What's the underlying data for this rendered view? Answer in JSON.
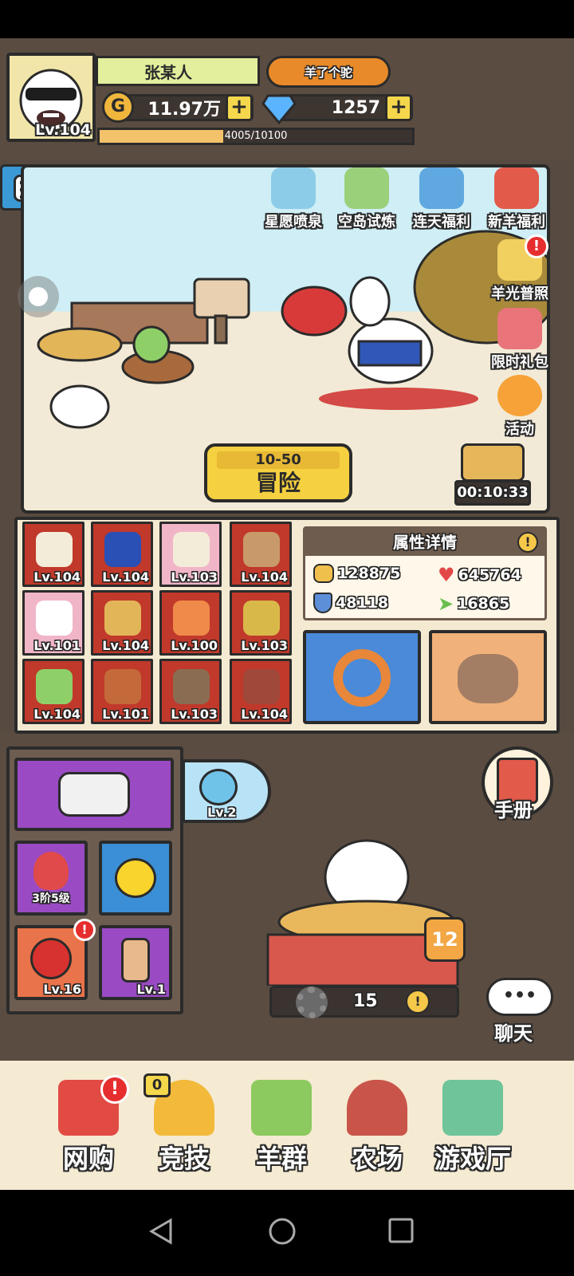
{
  "player": {
    "name": "张某人",
    "level": "Lv.104",
    "title": "羊了个驼"
  },
  "currency": {
    "gold": "11.97万",
    "diamond": "1257"
  },
  "exp": {
    "text": "4005/10100",
    "progress": 0.3965
  },
  "events": {
    "fountain": "星愿喷泉",
    "island": "空岛试炼",
    "daily": "连天福利",
    "newbie": "新羊福利",
    "photo": "羊光普照",
    "gift": "限时礼包",
    "activity": "活动"
  },
  "adventure": {
    "stage": "10-50",
    "label": "冒险"
  },
  "timer": "00:10:33",
  "equipment": [
    "Lv.104",
    "Lv.104",
    "Lv.103",
    "Lv.104",
    "Lv.101",
    "Lv.104",
    "Lv.100",
    "Lv.103",
    "Lv.104",
    "Lv.101",
    "Lv.103",
    "Lv.104"
  ],
  "attributes": {
    "title": "属性详情",
    "attack": "128875",
    "hp": "645764",
    "defense": "48118",
    "speed": "16865"
  },
  "pet": {
    "level": "Lv.2"
  },
  "inventory": {
    "tier": "3阶5级",
    "parrot_level": "Lv.16",
    "comb_level": "Lv.1"
  },
  "handbook": "手册",
  "nest": {
    "level": "12",
    "count": "15"
  },
  "chat": "聊天",
  "nav": {
    "shop": "网购",
    "arena": "竞技",
    "arena_badge": "0",
    "flock": "羊群",
    "farm": "农场",
    "hall": "游戏厅"
  },
  "colors": {
    "accent_yellow": "#f5d040",
    "panel_brown": "#5b4c41",
    "equip_red": "#c0392b",
    "alert_red": "#e62e2e"
  }
}
